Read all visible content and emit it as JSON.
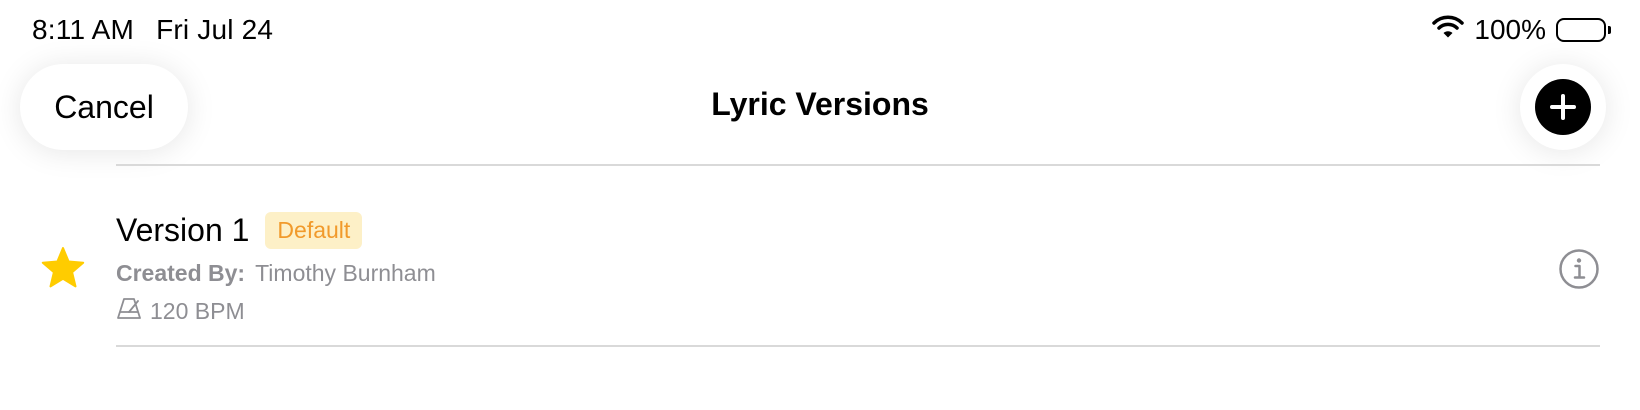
{
  "status_bar": {
    "time": "8:11 AM",
    "date": "Fri Jul 24",
    "battery": "100%",
    "icons": [
      "wifi-icon",
      "battery-icon"
    ]
  },
  "nav": {
    "cancel_label": "Cancel",
    "title": "Lyric Versions",
    "add_icon": "plus-circle-icon"
  },
  "versions": [
    {
      "name": "Version 1",
      "badge": "Default",
      "created_label": "Created By:",
      "created_by": "Timothy Burnham",
      "bpm": "120 BPM",
      "icons": [
        "star-icon",
        "metronome-icon",
        "info-icon"
      ]
    }
  ],
  "colors": {
    "star": "#FFCC00",
    "badge_bg": "#FDF0C7",
    "badge_text": "#F19A2B",
    "secondary_text": "#8E8E93"
  }
}
